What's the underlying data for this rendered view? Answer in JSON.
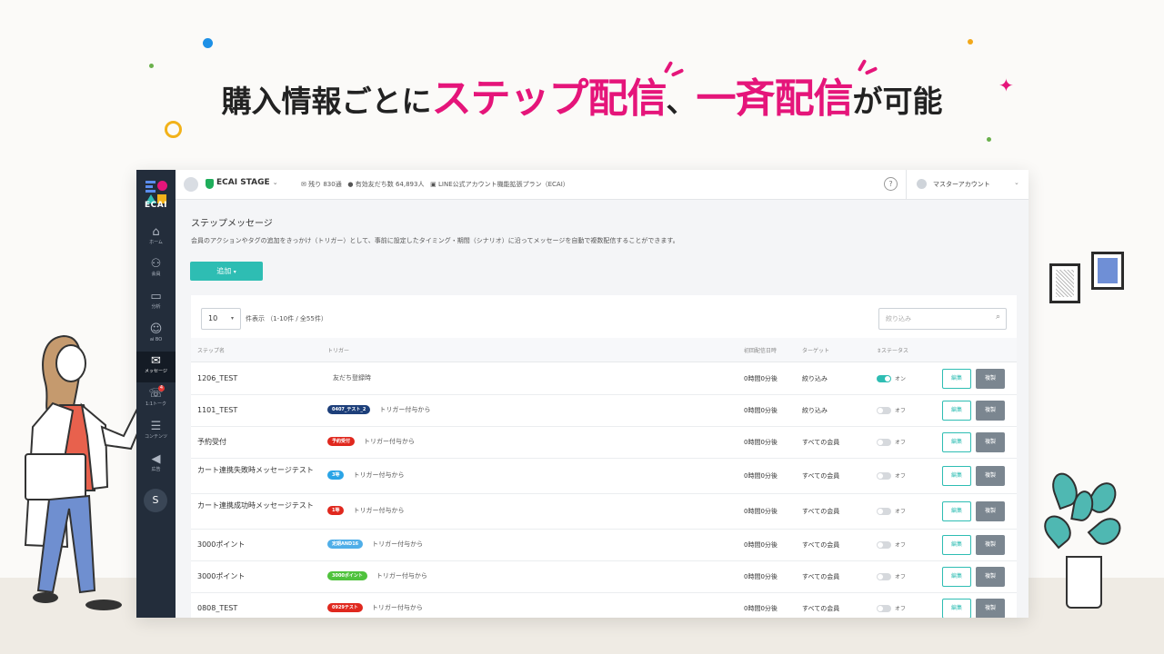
{
  "headline": {
    "part1": "購入情報ごとに",
    "accent1": "ステップ配信",
    "sep": "、",
    "accent2": "一斉配信",
    "part2": "が可能"
  },
  "colors": {
    "accent": "#e5157a",
    "teal": "#2ebdb3",
    "sidebar": "#232d3b"
  },
  "sidebar": {
    "logo_text": "ECAI",
    "items": [
      {
        "label": "ホーム",
        "icon": "home-icon"
      },
      {
        "label": "会員",
        "icon": "users-icon"
      },
      {
        "label": "分析",
        "icon": "chart-icon"
      },
      {
        "label": "ai BO",
        "icon": "robot-icon"
      },
      {
        "label": "メッセージ",
        "icon": "message-icon"
      },
      {
        "label": "1:1トーク",
        "icon": "chat-icon",
        "badge": "4"
      },
      {
        "label": "コンテンツ",
        "icon": "content-icon"
      },
      {
        "label": "広告",
        "icon": "megaphone-icon"
      }
    ],
    "shop_icon": "shopify-icon"
  },
  "topbar": {
    "stage": "ECAI STAGE",
    "remaining": "残り 830通",
    "friends": "有効友だち数 64,893人",
    "plan": "LINE公式アカウント機能拡張プラン（ECAI）",
    "help": "?",
    "user": "マスターアカウント"
  },
  "page": {
    "title": "ステップメッセージ",
    "description": "会員のアクションやタグの追加をきっかけ（トリガー）として、事前に設定したタイミング・期間（シナリオ）に沿ってメッセージを自動で複数配信することができます。",
    "add_button": "追加"
  },
  "table_controls": {
    "per_page": "10",
    "count_label": "件表示 （1-10件 / 全55件）",
    "search_placeholder": "絞り込み"
  },
  "table": {
    "headers": {
      "name": "ステップ名",
      "trigger": "トリガー",
      "first_time": "初回配信日時",
      "target": "ターゲット",
      "status": "ステータス"
    },
    "rows": [
      {
        "name": "1206_TEST",
        "tag": "",
        "tag_color": "",
        "trigger": "友だち登録時",
        "time": "0時間0分後",
        "target": "絞り込み",
        "status": "オン",
        "on": true,
        "edit": "編集",
        "copy": "複製"
      },
      {
        "name": "1101_TEST",
        "tag": "0407_テスト_2",
        "tag_color": "#1d3f7a",
        "trigger": "トリガー付与から",
        "time": "0時間0分後",
        "target": "絞り込み",
        "status": "オフ",
        "on": false,
        "edit": "編集",
        "copy": "複製"
      },
      {
        "name": "予約受付",
        "tag": "予約受付",
        "tag_color": "#e0281e",
        "trigger": "トリガー付与から",
        "time": "0時間0分後",
        "target": "すべての会員",
        "status": "オフ",
        "on": false,
        "edit": "編集",
        "copy": "複製"
      },
      {
        "name": "カート連携失敗時メッセージテスト",
        "tag": "3等",
        "tag_color": "#2aa4e6",
        "trigger": "トリガー付与から",
        "time": "0時間0分後",
        "target": "すべての会員",
        "status": "オフ",
        "on": false,
        "edit": "編集",
        "copy": "複製"
      },
      {
        "name": "カート連携成功時メッセージテスト",
        "tag": "1等",
        "tag_color": "#e0281e",
        "trigger": "トリガー付与から",
        "time": "0時間0分後",
        "target": "すべての会員",
        "status": "オフ",
        "on": false,
        "edit": "編集",
        "copy": "複製"
      },
      {
        "name": "3000ポイント",
        "tag": "定期AND16",
        "tag_color": "#4faee8",
        "trigger": "トリガー付与から",
        "time": "0時間0分後",
        "target": "すべての会員",
        "status": "オフ",
        "on": false,
        "edit": "編集",
        "copy": "複製"
      },
      {
        "name": "3000ポイント",
        "tag": "3000ポイント",
        "tag_color": "#4fc23d",
        "trigger": "トリガー付与から",
        "time": "0時間0分後",
        "target": "すべての会員",
        "status": "オフ",
        "on": false,
        "edit": "編集",
        "copy": "複製"
      },
      {
        "name": "0808_TEST",
        "tag": "0929テスト",
        "tag_color": "#e0281e",
        "trigger": "トリガー付与から",
        "time": "0時間0分後",
        "target": "すべての会員",
        "status": "オフ",
        "on": false,
        "edit": "編集",
        "copy": "複製"
      }
    ]
  }
}
